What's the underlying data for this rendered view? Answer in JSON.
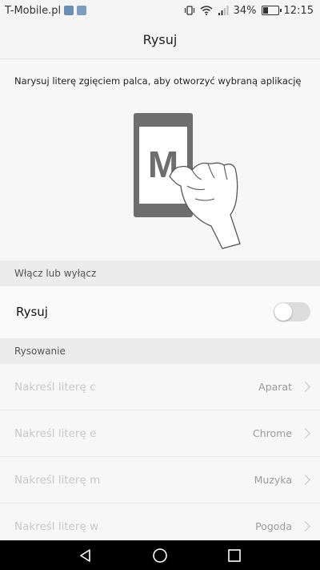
{
  "status_bar": {
    "carrier": "T-Mobile.pl",
    "battery_percent": "34%",
    "battery_level": 0.34,
    "time": "12:15",
    "icons": [
      "notification-icon",
      "photo-icon",
      "vibrate-icon",
      "wifi-icon",
      "signal-icon",
      "battery-icon"
    ]
  },
  "header": {
    "title": "Rysuj"
  },
  "description": "Narysuj literę zgięciem palca, aby otworzyć wybraną aplikację",
  "illustration": {
    "letter": "M"
  },
  "sections": {
    "toggle_header": "Włącz lub wyłącz",
    "drawing_header": "Rysowanie"
  },
  "toggle": {
    "label": "Rysuj",
    "enabled": false
  },
  "gestures": [
    {
      "label": "Nakreśl literę c",
      "app": "Aparat"
    },
    {
      "label": "Nakreśl literę e",
      "app": "Chrome"
    },
    {
      "label": "Nakreśl literę m",
      "app": "Muzyka"
    },
    {
      "label": "Nakreśl literę w",
      "app": "Pogoda"
    }
  ],
  "navbar": {
    "icons": [
      "back-icon",
      "home-icon",
      "recents-icon"
    ]
  }
}
